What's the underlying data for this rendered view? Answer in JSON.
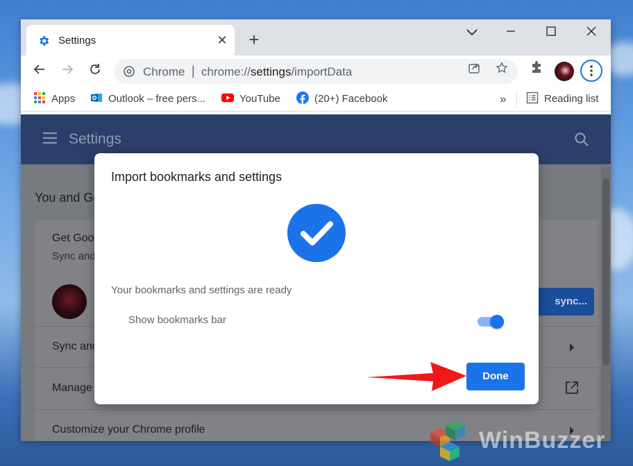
{
  "tab": {
    "title": "Settings"
  },
  "omnibox": {
    "site": "Chrome",
    "separator": "|",
    "url_host": "chrome://",
    "url_path": "settings",
    "url_rest": "/importData"
  },
  "bookmarks": [
    {
      "label": "Apps",
      "icon": "apps-grid-icon"
    },
    {
      "label": "Outlook – free pers...",
      "icon": "outlook-icon"
    },
    {
      "label": "YouTube",
      "icon": "youtube-icon"
    },
    {
      "label": "(20+) Facebook",
      "icon": "facebook-icon"
    }
  ],
  "bookmarks_overflow": "»",
  "reading_list": "Reading list",
  "settings": {
    "title": "Settings"
  },
  "page": {
    "section_title": "You and Go",
    "get_google": "Get Goog",
    "sync_sub": "Sync and",
    "sync_button": "sync...",
    "row_sync": "Sync and",
    "row_manage": "Manage",
    "row_customize": "Customize your Chrome profile"
  },
  "dialog": {
    "title": "Import bookmarks and settings",
    "ready": "Your bookmarks and settings are ready",
    "show_bookmarks_bar": "Show bookmarks bar",
    "toggle_on": true,
    "done": "Done"
  },
  "watermark": "WinBuzzer",
  "colors": {
    "accent": "#1a73e8",
    "arrow": "#f01818"
  }
}
